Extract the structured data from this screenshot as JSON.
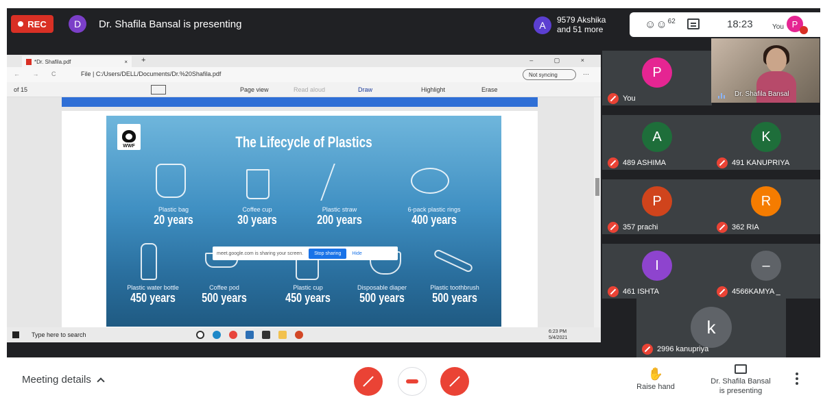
{
  "topbar": {
    "rec_label": "REC",
    "presenter_avatar": "D",
    "presenting_text": "Dr. Shafila Bansal is presenting",
    "akshika_avatar": "A",
    "akshika_name": "9579 Akshika",
    "akshika_more": "and 51 more",
    "people_count": "62",
    "time": "18:23",
    "you_label": "You",
    "you_avatar": "P"
  },
  "screen": {
    "tab_title": "*Dr. Shafila.pdf",
    "url": "File  |  C:/Users/DELL/Documents/Dr.%20Shafila.pdf",
    "not_syncing": "Not syncing",
    "page_count": "of 15",
    "page_view": "Page view",
    "read_aloud": "Read aloud",
    "draw": "Draw",
    "highlight": "Highlight",
    "erase": "Erase",
    "slide_title": "The Lifecycle of Plastics",
    "wwf": "WWF",
    "items": [
      {
        "label": "Plastic bag",
        "years": "20 years"
      },
      {
        "label": "Coffee cup",
        "years": "30 years"
      },
      {
        "label": "Plastic straw",
        "years": "200 years"
      },
      {
        "label": "6-pack plastic rings",
        "years": "400 years"
      },
      {
        "label": "Plastic water bottle",
        "years": "450 years"
      },
      {
        "label": "Coffee pod",
        "years": "500 years"
      },
      {
        "label": "Plastic cup",
        "years": "450 years"
      },
      {
        "label": "Disposable diaper",
        "years": "500 years"
      },
      {
        "label": "Plastic toothbrush",
        "years": "500 years"
      }
    ],
    "share_text": "meet.google.com is sharing your screen.",
    "stop_sharing": "Stop sharing",
    "hide": "Hide",
    "taskbar_search": "Type here to search",
    "taskbar_time": "6:23 PM",
    "taskbar_date": "5/4/2021"
  },
  "participants": [
    {
      "initial": "P",
      "name": "You",
      "color": "#e52592"
    },
    {
      "initial": "A",
      "name": "489 ASHIMA",
      "color": "#1e6e3a"
    },
    {
      "initial": "K",
      "name": "491 KANUPRIYA",
      "color": "#1e6e3a"
    },
    {
      "initial": "P",
      "name": "357 prachi",
      "color": "#d0441c"
    },
    {
      "initial": "R",
      "name": "362 RIA",
      "color": "#f57c00"
    },
    {
      "initial": "I",
      "name": "461 ISHTA",
      "color": "#8e44ce"
    },
    {
      "initial": "–",
      "name": "4566KAMYA _",
      "color": "#5f6368"
    },
    {
      "initial": "k",
      "name": "2996 kanupriya",
      "color": "#5f6368"
    }
  ],
  "presenter_tile_name": "Dr. Shafila Bansal",
  "bottom": {
    "meeting_details": "Meeting details",
    "raise_hand": "Raise hand",
    "presenting_line1": "Dr. Shafila Bansal",
    "presenting_line2": "is presenting"
  }
}
